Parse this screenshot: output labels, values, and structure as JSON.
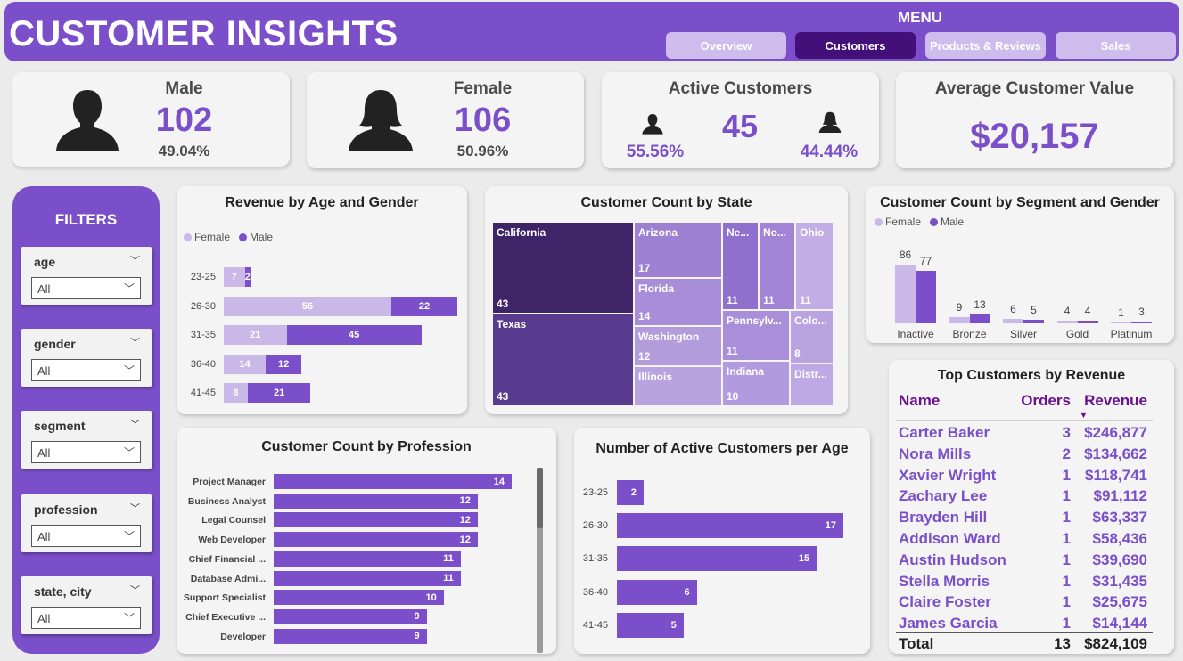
{
  "header": {
    "title": "CUSTOMER INSIGHTS",
    "menu_label": "MENU",
    "menu": [
      {
        "label": "Overview"
      },
      {
        "label": "Customers"
      },
      {
        "label": "Products & Reviews"
      },
      {
        "label": "Sales"
      }
    ]
  },
  "kpi": {
    "male": {
      "label": "Male",
      "value": "102",
      "pct": "49.04%"
    },
    "female": {
      "label": "Female",
      "value": "106",
      "pct": "50.96%"
    },
    "active": {
      "label": "Active Customers",
      "value": "45",
      "male_pct": "55.56%",
      "female_pct": "44.44%"
    },
    "avg": {
      "label": "Average Customer Value",
      "value": "$20,157"
    }
  },
  "filters": {
    "title": "FILTERS",
    "items": [
      {
        "name": "age",
        "value": "All"
      },
      {
        "name": "gender",
        "value": "All"
      },
      {
        "name": "segment",
        "value": "All"
      },
      {
        "name": "profession",
        "value": "All"
      },
      {
        "name": "state, city",
        "value": "All"
      }
    ]
  },
  "colors": {
    "female": "#c9b8e8",
    "male": "#7a4fc9",
    "dark": "#43107a",
    "text_purple": "#7a4fc9"
  },
  "chart_data": [
    {
      "type": "bar",
      "id": "age_gender",
      "title": "Revenue by Age and Gender",
      "stacked": true,
      "orientation": "horizontal",
      "legend": [
        "Female",
        "Male"
      ],
      "categories": [
        "23-25",
        "26-30",
        "31-35",
        "36-40",
        "41-45"
      ],
      "series": [
        {
          "name": "Female",
          "values": [
            7,
            56,
            21,
            14,
            8
          ]
        },
        {
          "name": "Male",
          "values": [
            2,
            22,
            45,
            12,
            21
          ]
        }
      ]
    },
    {
      "type": "treemap",
      "id": "state",
      "title": "Customer Count by State",
      "labels": [
        "California",
        "Texas",
        "Arizona",
        "Florida",
        "Washington",
        "Illinois",
        "Ne...",
        "No...",
        "Ohio",
        "Pennsylv...",
        "Colo...",
        "Indiana",
        "Distr..."
      ],
      "values": [
        43,
        43,
        17,
        14,
        12,
        null,
        11,
        11,
        11,
        11,
        8,
        10,
        null
      ]
    },
    {
      "type": "bar",
      "id": "segment",
      "title": "Customer Count by Segment and Gender",
      "legend": [
        "Female",
        "Male"
      ],
      "categories": [
        "Inactive",
        "Bronze",
        "Silver",
        "Gold",
        "Platinum"
      ],
      "series": [
        {
          "name": "Female",
          "values": [
            86,
            9,
            6,
            4,
            1
          ]
        },
        {
          "name": "Male",
          "values": [
            77,
            13,
            5,
            4,
            3
          ]
        }
      ]
    },
    {
      "type": "bar",
      "id": "profession",
      "title": "Customer Count by Profession",
      "orientation": "horizontal",
      "categories": [
        "Project Manager",
        "Business Analyst",
        "Legal Counsel",
        "Web Developer",
        "Chief Financial ...",
        "Database Admi...",
        "Support Specialist",
        "Chief Executive ...",
        "Developer"
      ],
      "values": [
        14,
        12,
        12,
        12,
        11,
        11,
        10,
        9,
        9
      ]
    },
    {
      "type": "bar",
      "id": "active_age",
      "title": "Number of Active Customers per Age",
      "orientation": "horizontal",
      "categories": [
        "23-25",
        "26-30",
        "31-35",
        "36-40",
        "41-45"
      ],
      "values": [
        2,
        17,
        15,
        6,
        5
      ]
    },
    {
      "type": "table",
      "id": "top_customers",
      "title": "Top Customers by Revenue",
      "columns": [
        "Name",
        "Orders",
        "Revenue"
      ],
      "rows": [
        [
          "Carter Baker",
          "3",
          "$246,877"
        ],
        [
          "Nora Mills",
          "2",
          "$134,662"
        ],
        [
          "Xavier Wright",
          "1",
          "$118,741"
        ],
        [
          "Zachary Lee",
          "1",
          "$91,112"
        ],
        [
          "Brayden Hill",
          "1",
          "$63,337"
        ],
        [
          "Addison Ward",
          "1",
          "$58,436"
        ],
        [
          "Austin Hudson",
          "1",
          "$39,690"
        ],
        [
          "Stella Morris",
          "1",
          "$31,435"
        ],
        [
          "Claire Foster",
          "1",
          "$25,675"
        ],
        [
          "James Garcia",
          "1",
          "$14,144"
        ]
      ],
      "total": [
        "Total",
        "13",
        "$824,109"
      ]
    }
  ]
}
